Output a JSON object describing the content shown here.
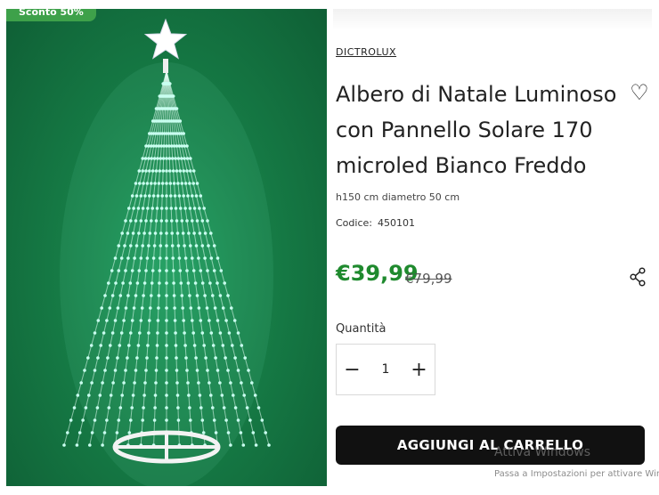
{
  "product": {
    "discount_badge": "Sconto 50%",
    "brand": "DICTROLUX",
    "title": "Albero di Natale Luminoso con Pannello Solare 170 microled Bianco Freddo",
    "dimensions": "h150 cm diametro 50 cm",
    "code_label": "Codice:",
    "code_value": "450101",
    "price_current": "€39,99",
    "price_old": "€79,99",
    "quantity_label": "Quantità",
    "quantity_value": "1",
    "add_to_cart_label": "AGGIUNGI AL CARRELLO"
  },
  "icons": {
    "wishlist": "heart-outline-icon",
    "share": "share-icon",
    "minus": "minus-icon",
    "plus": "plus-icon",
    "tree": "christmas-tree-lights-image"
  },
  "watermark": {
    "title": "Attiva Windows",
    "subtitle": "Passa a Impostazioni per attivare Windows."
  },
  "colors": {
    "price": "#1f8a2e",
    "badge": "#3ea14a",
    "button": "#111111",
    "image_bg": "#167c46"
  }
}
